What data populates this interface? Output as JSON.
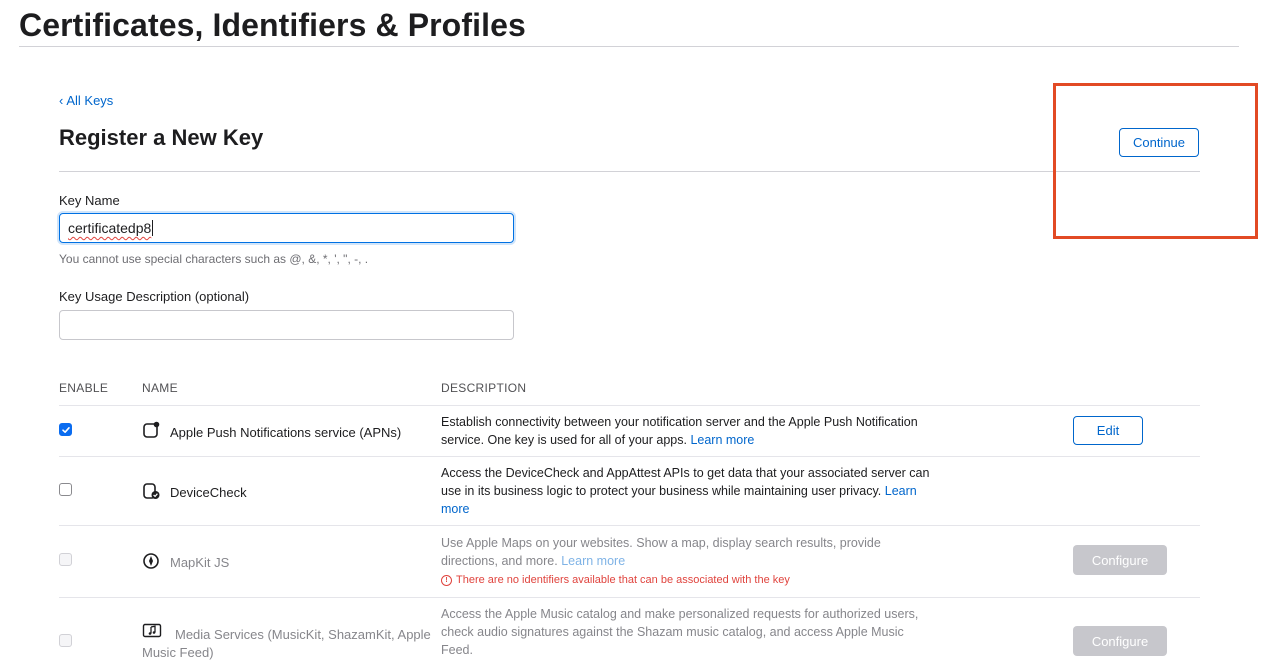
{
  "page": {
    "title": "Certificates, Identifiers & Profiles"
  },
  "nav": {
    "back_label": "All Keys",
    "back_chevron": "‹"
  },
  "form": {
    "title": "Register a New Key",
    "continue_label": "Continue",
    "key_name_label": "Key Name",
    "key_name_value": "certificatedp8",
    "key_name_hint": "You cannot use special characters such as @, &, *, ', \", -, .",
    "usage_label": "Key Usage Description (optional)",
    "usage_value": ""
  },
  "table": {
    "headers": {
      "enable": "ENABLE",
      "name": "NAME",
      "description": "DESCRIPTION"
    },
    "rows": [
      {
        "name": "Apple Push Notifications service (APNs)",
        "icon": "push-notification-icon",
        "checked": true,
        "enabled": true,
        "description": "Establish connectivity between your notification server and the Apple Push Notification service. One key is used for all of your apps.",
        "learn_more": "Learn more",
        "action": "Edit"
      },
      {
        "name": "DeviceCheck",
        "icon": "device-check-icon",
        "checked": false,
        "enabled": true,
        "description": "Access the DeviceCheck and AppAttest APIs to get data that your associated server can use in its business logic to protect your business while maintaining user privacy.",
        "learn_more": "Learn more",
        "action": ""
      },
      {
        "name": "MapKit JS",
        "icon": "mapkit-icon",
        "checked": false,
        "enabled": false,
        "description": "Use Apple Maps on your websites. Show a map, display search results, provide directions, and more.",
        "learn_more": "Learn more",
        "warning": "There are no identifiers available that can be associated with the key",
        "warning_glyph": "!",
        "action": "Configure"
      },
      {
        "name": "Media Services (MusicKit, ShazamKit, Apple Music Feed)",
        "icon": "media-services-icon",
        "checked": false,
        "enabled": false,
        "description": "Access the Apple Music catalog and make personalized requests for authorized users, check audio signatures against the Shazam music catalog, and access Apple Music Feed.",
        "action": "Configure"
      }
    ]
  },
  "colors": {
    "accent": "#0066cc",
    "highlight": "#e24a24",
    "warning": "#e0443e"
  }
}
